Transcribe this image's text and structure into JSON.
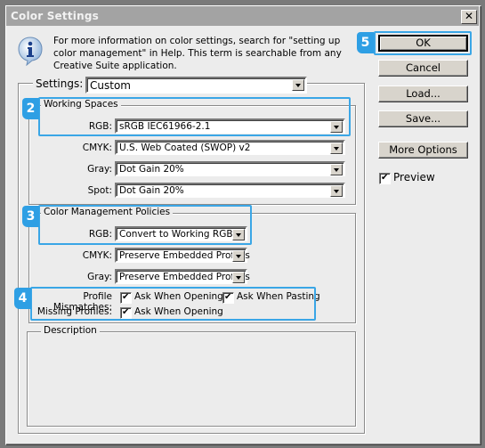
{
  "window": {
    "title": "Color Settings",
    "close_icon": "close-x-icon"
  },
  "info": {
    "icon": "info-icon",
    "lines": [
      "For more information on color settings, search for \"setting up",
      "color management\" in Help. This term is searchable from any",
      "Creative Suite application."
    ]
  },
  "settings": {
    "label": "Settings:",
    "value": "Custom"
  },
  "working_spaces": {
    "title": "Working Spaces",
    "rgb": {
      "label": "RGB:",
      "value": "sRGB IEC61966-2.1"
    },
    "cmyk": {
      "label": "CMYK:",
      "value": "U.S. Web Coated (SWOP) v2"
    },
    "gray": {
      "label": "Gray:",
      "value": "Dot Gain 20%"
    },
    "spot": {
      "label": "Spot:",
      "value": "Dot Gain 20%"
    }
  },
  "policies": {
    "title": "Color Management Policies",
    "rgb": {
      "label": "RGB:",
      "value": "Convert to Working RGB"
    },
    "cmyk": {
      "label": "CMYK:",
      "value": "Preserve Embedded Profiles"
    },
    "gray": {
      "label": "Gray:",
      "value": "Preserve Embedded Profiles"
    },
    "profile_mismatches": {
      "label": "Profile Mismatches:",
      "ask_opening": {
        "label": "Ask When Opening",
        "checked": true
      },
      "ask_pasting": {
        "label": "Ask When Pasting",
        "checked": true
      }
    },
    "missing_profiles": {
      "label": "Missing Profiles:",
      "ask_opening": {
        "label": "Ask When Opening",
        "checked": true
      }
    }
  },
  "description": {
    "title": "Description",
    "text": ""
  },
  "buttons": {
    "ok": "OK",
    "cancel": "Cancel",
    "load": "Load...",
    "save": "Save...",
    "more_options": "More Options"
  },
  "preview": {
    "label": "Preview",
    "checked": true
  },
  "callouts": {
    "working_spaces": "2",
    "policies": "3",
    "missing": "4",
    "ok": "5",
    "color": "#2e9fe4"
  }
}
